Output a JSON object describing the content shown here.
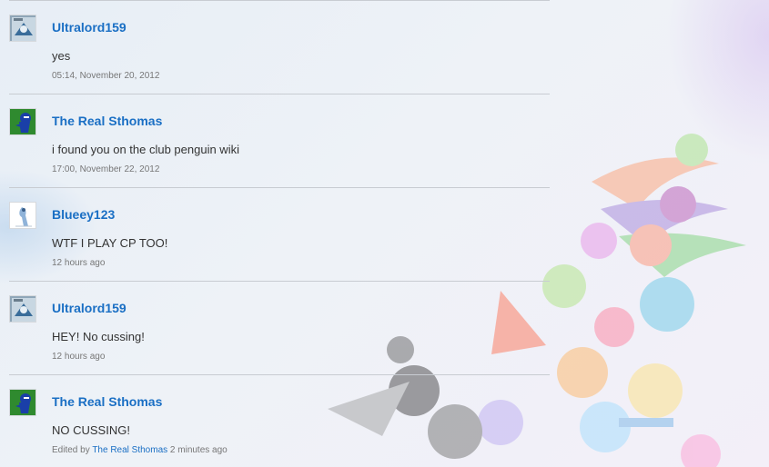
{
  "comments": [
    {
      "avatar": "blue-swirl-avatar",
      "username": "Ultralord159",
      "text": "yes",
      "timestamp": "05:14, November 20, 2012"
    },
    {
      "avatar": "blue-figure-green-avatar",
      "username": "The Real Sthomas",
      "text": "i found you on the club penguin wiki",
      "timestamp": "17:00, November 22, 2012"
    },
    {
      "avatar": "bird-white-avatar",
      "username": "Blueey123",
      "text": "WTF I PLAY CP TOO!",
      "timestamp": "12 hours ago"
    },
    {
      "avatar": "blue-swirl-avatar",
      "username": "Ultralord159",
      "text": "HEY! No cussing!",
      "timestamp": "12 hours ago"
    },
    {
      "avatar": "blue-figure-green-avatar",
      "username": "The Real Sthomas",
      "text": "NO CUSSING!",
      "edited_prefix": "Edited by",
      "editor": "The Real Sthomas",
      "edited_time": "2 minutes ago"
    }
  ],
  "colors": {
    "link": "#1a6fc4",
    "text": "#333333",
    "meta": "#777777",
    "divider": "#c8ccd2"
  }
}
